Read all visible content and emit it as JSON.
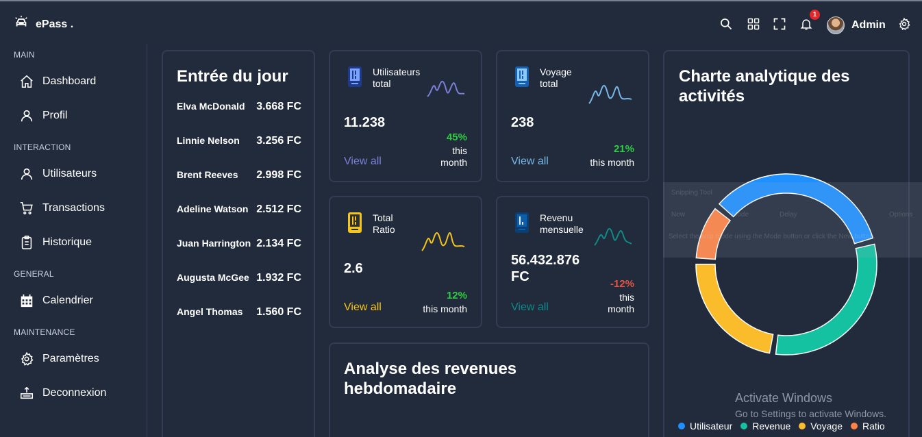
{
  "brand": {
    "name": "ePass ."
  },
  "topbar": {
    "notifications_count": "1",
    "user_name": "Admin"
  },
  "sidebar": {
    "sections": [
      {
        "title": "MAIN",
        "items": [
          {
            "label": "Dashboard",
            "icon": "home-icon"
          },
          {
            "label": "Profil",
            "icon": "user-icon"
          }
        ]
      },
      {
        "title": "INTERACTION",
        "items": [
          {
            "label": "Utilisateurs",
            "icon": "user-icon"
          },
          {
            "label": "Transactions",
            "icon": "cart-icon"
          },
          {
            "label": "Historique",
            "icon": "clipboard-icon"
          }
        ]
      },
      {
        "title": "GENERAL",
        "items": [
          {
            "label": "Calendrier",
            "icon": "calendar-icon"
          }
        ]
      },
      {
        "title": "MAINTENANCE",
        "items": [
          {
            "label": "Paramètres",
            "icon": "gear-icon"
          },
          {
            "label": "Deconnexion",
            "icon": "logout-icon"
          }
        ]
      }
    ]
  },
  "entries": {
    "title": "Entrée du jour",
    "rows": [
      {
        "name": "Elva McDonald",
        "amount": "3.668 FC"
      },
      {
        "name": "Linnie Nelson",
        "amount": "3.256 FC"
      },
      {
        "name": "Brent Reeves",
        "amount": "2.998 FC"
      },
      {
        "name": "Adeline Watson",
        "amount": "2.512 FC"
      },
      {
        "name": "Juan Harrington",
        "amount": "2.134 FC"
      },
      {
        "name": "Augusta McGee",
        "amount": "1.932 FC"
      },
      {
        "name": "Angel Thomas",
        "amount": "1.560 FC"
      }
    ]
  },
  "stats": [
    {
      "title1": "Utilisateurs",
      "title2": "total",
      "value": "11.238",
      "pct": "45%",
      "pct_label1": "this",
      "pct_label2": "month",
      "view_all": "View all",
      "accent": "#7b7fd6",
      "pct_color": "#2ecc40"
    },
    {
      "title1": "Voyage",
      "title2": "total",
      "value": "238",
      "pct": "21%",
      "pct_label1": "this month",
      "pct_label2": "",
      "view_all": "View all",
      "accent": "#78b8e6",
      "pct_color": "#2ecc40"
    },
    {
      "title1": "Total",
      "title2": "Ratio",
      "value": "2.6",
      "pct": "12%",
      "pct_label1": "this month",
      "pct_label2": "",
      "view_all": "View all",
      "accent": "#f5c518",
      "pct_color": "#2ecc40"
    },
    {
      "title1": "Revenu",
      "title2": "mensuelle",
      "value": "56.432.876",
      "value2": "FC",
      "pct": "-12%",
      "pct_label1": "this",
      "pct_label2": "month",
      "view_all": "View all",
      "accent": "#0f8a86",
      "pct_color": "#e55343"
    }
  ],
  "weekly": {
    "title1": "Analyse des revenues",
    "title2": "hebdomadaire"
  },
  "activity": {
    "title1": "Charte analytique des",
    "title2": "activités"
  },
  "chart_data": {
    "type": "pie",
    "variant": "donut",
    "labels": [
      "Utilisateur",
      "Revenue",
      "Voyage",
      "Ratio"
    ],
    "values": [
      33,
      30,
      22,
      10
    ],
    "colors": [
      "#1e90ff",
      "#14c1a0",
      "#fbbc2c",
      "#ff8243"
    ],
    "legend": "bottom"
  },
  "watermark": {
    "line1": "Activate Windows",
    "line2": "Go to Settings to activate Windows."
  },
  "snipping": {
    "title": "Snipping Tool",
    "new": "New",
    "mode": "Mode",
    "delay": "Delay",
    "options": "Options",
    "help": "Select the snip mode using the Mode button or click the New button."
  }
}
